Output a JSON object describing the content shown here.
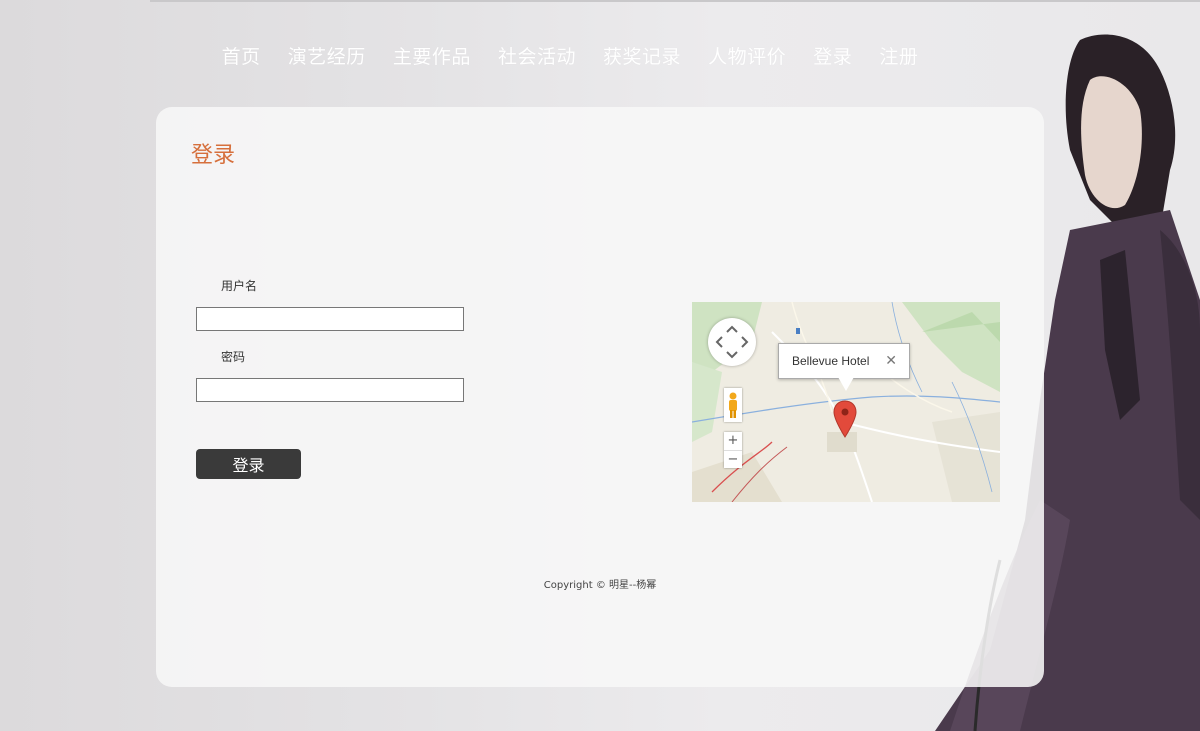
{
  "nav": {
    "items": [
      "首页",
      "演艺经历",
      "主要作品",
      "社会活动",
      "获奖记录",
      "人物评价",
      "登录",
      "注册"
    ]
  },
  "login": {
    "title": "登录",
    "username_label": "用户名",
    "username_value": "",
    "password_label": "密码",
    "password_value": "",
    "submit_label": "登录"
  },
  "map": {
    "info_title": "Bellevue Hotel",
    "close_glyph": "✕",
    "zoom_in": "+",
    "zoom_out": "−"
  },
  "footer": {
    "copyright": "Copyright © 明星--杨幂"
  },
  "colors": {
    "title_accent": "#d66f3c",
    "button_bg": "#3a3a3a",
    "nav_text": "#ffffff"
  }
}
